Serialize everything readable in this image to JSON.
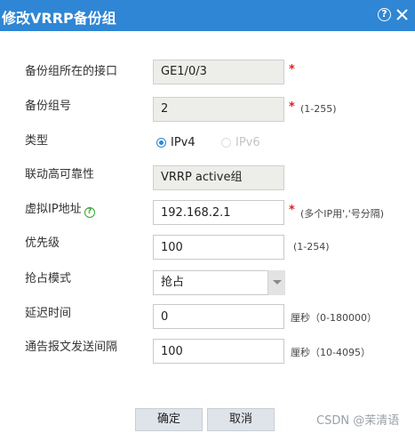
{
  "dialog": {
    "title": "修改VRRP备份组",
    "help_glyph": "?",
    "close_glyph": "×"
  },
  "form": {
    "interface": {
      "label": "备份组所在的接口",
      "value": "GE1/0/3",
      "required": "*"
    },
    "group_id": {
      "label": "备份组号",
      "value": "2",
      "required": "*",
      "hint": "(1-255)"
    },
    "type": {
      "label": "类型",
      "options": [
        {
          "label": "IPv4",
          "selected": true
        },
        {
          "label": "IPv6",
          "selected": false
        }
      ]
    },
    "linkage": {
      "label": "联动高可靠性",
      "value": "VRRP active组"
    },
    "virtual_ip": {
      "label": "虚拟IP地址",
      "help_glyph": "?",
      "value": "192.168.2.1",
      "required": "*",
      "hint": "(多个IP用','号分隔)"
    },
    "priority": {
      "label": "优先级",
      "value": "100",
      "hint": "(1-254)"
    },
    "preempt_mode": {
      "label": "抢占模式",
      "value": "抢占"
    },
    "delay": {
      "label": "延迟时间",
      "value": "0",
      "hint": "厘秒（0-180000）"
    },
    "advert_interval": {
      "label": "通告报文发送间隔",
      "value": "100",
      "hint": "厘秒（10-4095）"
    }
  },
  "buttons": {
    "ok": "确定",
    "cancel": "取消"
  },
  "watermark": "CSDN @茉清语",
  "colors": {
    "title_bar": "#2f86d4",
    "required": "#e02020",
    "help_icon": "#37a12f",
    "radio_accent": "#2f86d4"
  }
}
